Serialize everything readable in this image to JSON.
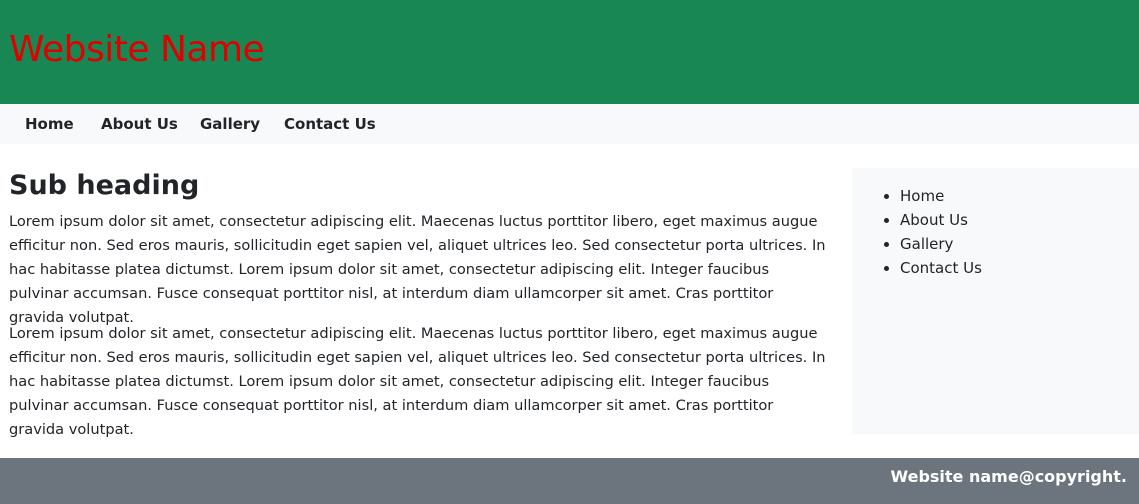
{
  "header": {
    "site_name": "Website Name"
  },
  "nav": {
    "items": [
      "Home",
      "About Us",
      "Gallery",
      "Contact Us"
    ]
  },
  "main": {
    "heading": "Sub heading",
    "paragraphs": [
      "Lorem ipsum dolor sit amet, consectetur adipiscing elit. Maecenas luctus porttitor libero, eget maximus augue efficitur non. Sed eros mauris, sollicitudin eget sapien vel, aliquet ultrices leo. Sed consectetur porta ultrices. In hac habitasse platea dictumst. Lorem ipsum dolor sit amet, consectetur adipiscing elit. Integer faucibus pulvinar accumsan. Fusce consequat porttitor nisl, at interdum diam ullamcorper sit amet. Cras porttitor gravida volutpat.",
      "Lorem ipsum dolor sit amet, consectetur adipiscing elit. Maecenas luctus porttitor libero, eget maximus augue efficitur non. Sed eros mauris, sollicitudin eget sapien vel, aliquet ultrices leo. Sed consectetur porta ultrices. In hac habitasse platea dictumst. Lorem ipsum dolor sit amet, consectetur adipiscing elit. Integer faucibus pulvinar accumsan. Fusce consequat porttitor nisl, at interdum diam ullamcorper sit amet. Cras porttitor gravida volutpat."
    ]
  },
  "sidebar": {
    "items": [
      "Home",
      "About Us",
      "Gallery",
      "Contact Us"
    ]
  },
  "footer": {
    "text": "Website name@copyright."
  },
  "colors": {
    "header_bg": "#198754",
    "site_name": "#e00000",
    "navbar_bg": "#f8f9fa",
    "sidebar_bg": "#f8f9fa",
    "footer_bg": "#6c757d",
    "footer_text": "#ffffff"
  }
}
